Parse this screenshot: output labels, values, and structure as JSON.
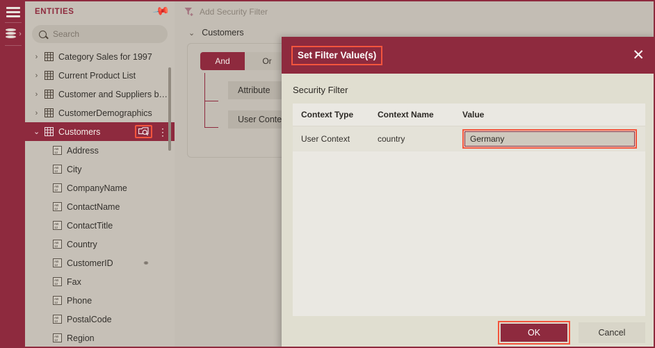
{
  "rail": {
    "menu_icon": "hamburger-menu-icon",
    "database_icon": "database-stack-icon",
    "expand_chevron": "›"
  },
  "entities_panel": {
    "title": "ENTITIES",
    "pin_icon": "pin-icon",
    "search": {
      "placeholder": "Search",
      "value": "",
      "icon": "search-icon"
    },
    "items": [
      {
        "label": "Category Sales for 1997",
        "type": "entity",
        "expanded": false,
        "selected": false
      },
      {
        "label": "Current Product List",
        "type": "entity",
        "expanded": false,
        "selected": false
      },
      {
        "label": "Customer and Suppliers by City",
        "type": "entity",
        "expanded": false,
        "selected": false
      },
      {
        "label": "CustomerDemographics",
        "type": "entity",
        "expanded": false,
        "selected": false
      },
      {
        "label": "Customers",
        "type": "entity",
        "expanded": true,
        "selected": true
      },
      {
        "label": "Address",
        "type": "attribute"
      },
      {
        "label": "City",
        "type": "attribute"
      },
      {
        "label": "CompanyName",
        "type": "attribute"
      },
      {
        "label": "ContactName",
        "type": "attribute"
      },
      {
        "label": "ContactTitle",
        "type": "attribute"
      },
      {
        "label": "Country",
        "type": "attribute"
      },
      {
        "label": "CustomerID",
        "type": "attribute",
        "badge": "key-link-icon"
      },
      {
        "label": "Fax",
        "type": "attribute"
      },
      {
        "label": "Phone",
        "type": "attribute"
      },
      {
        "label": "PostalCode",
        "type": "attribute"
      },
      {
        "label": "Region",
        "type": "attribute"
      }
    ],
    "selected_row_actions": {
      "search_entity_icon": "entity-search-icon",
      "overflow_icon": "kebab-menu-icon"
    }
  },
  "toolbar": {
    "add_security_filter_label": "Add Security Filter",
    "add_security_filter_icon": "filter-plus-icon",
    "enabled": false
  },
  "filter_panel": {
    "entity_label": "Customers",
    "entity_chevron": "chevron-down-icon",
    "logic": {
      "and_label": "And",
      "or_label": "Or",
      "selected": "And"
    },
    "conditions": [
      {
        "label": "Attribute",
        "chevron": "chevron-down-icon"
      },
      {
        "label": "User Context",
        "chevron": "chevron-down-icon"
      }
    ]
  },
  "dialog": {
    "title": "Set Filter Value(s)",
    "close_icon": "close-icon",
    "subtitle": "Security Filter",
    "table": {
      "columns": [
        "Context Type",
        "Context Name",
        "Value"
      ],
      "rows": [
        {
          "context_type": "User Context",
          "context_name": "country",
          "value": "Germany"
        }
      ]
    },
    "footer": {
      "ok_label": "OK",
      "cancel_label": "Cancel"
    }
  },
  "colors": {
    "brand": "#8E2A3E",
    "highlight": "#F4553D",
    "panel_bg": "#C3BDB4",
    "dialog_bg": "#E0DED0",
    "table_bg": "#EAE8E2"
  }
}
